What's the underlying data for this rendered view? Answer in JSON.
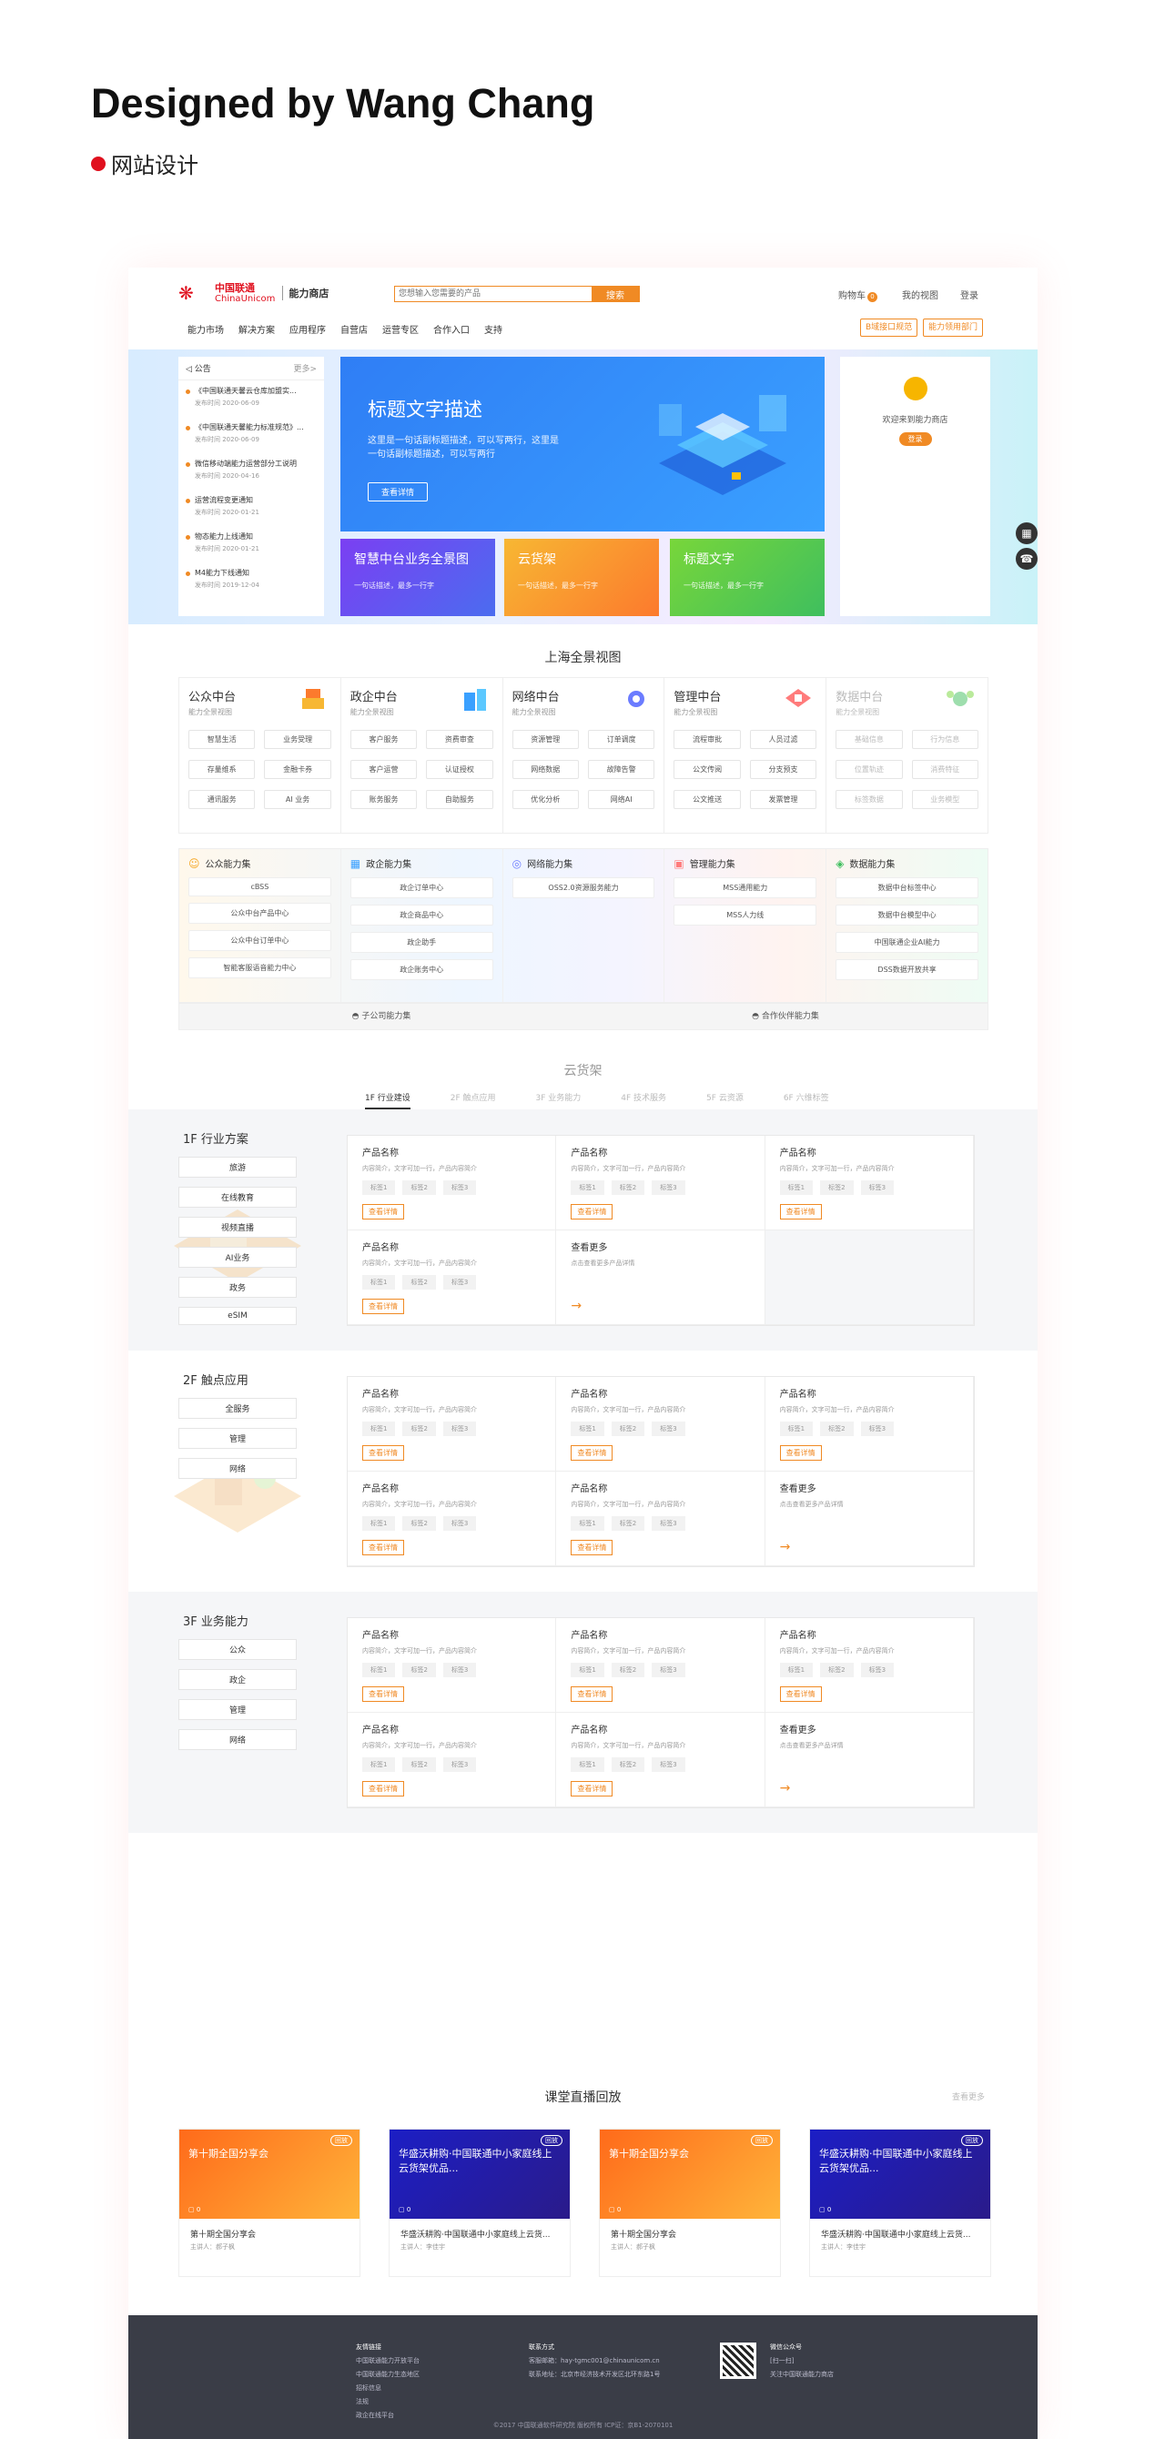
{
  "header": {
    "title": "Designed by Wang Chang",
    "subtitle": "网站设计"
  },
  "topbar": {
    "logo_cn": "中国联通",
    "logo_en": "ChinaUnicom",
    "logo_shop": "能力商店",
    "search_placeholder": "您想输入您需要的产品",
    "search_btn": "搜索",
    "cart": "购物车",
    "cart_count": "0",
    "my_view": "我的视图",
    "login": "登录"
  },
  "nav": {
    "items": [
      "能力市场",
      "解决方案",
      "应用程序",
      "自营店",
      "运营专区",
      "合作入口",
      "支持"
    ],
    "btn1": "B域接口规范",
    "btn2": "能力领用部门"
  },
  "notice": {
    "title": "公告",
    "more": "更多>",
    "items": [
      {
        "t": "《中国联通天馨云仓库加盟实...",
        "d": "发布时间 2020-06-09"
      },
      {
        "t": "《中国联通天馨能力标准规范》...",
        "d": "发布时间 2020-06-09"
      },
      {
        "t": "微信移动端能力运营部分工说明",
        "d": "发布时间 2020-04-16"
      },
      {
        "t": "运营流程变更通知",
        "d": "发布时间 2020-01-21"
      },
      {
        "t": "物态能力上线通知",
        "d": "发布时间 2020-01-21"
      },
      {
        "t": "M4能力下线通知",
        "d": "发布时间 2019-12-04"
      }
    ]
  },
  "banner": {
    "h": "标题文字描述",
    "p": "这里是一句话副标题描述，可以写两行，这里是一句话副标题描述，可以写两行",
    "btn": "查看详情"
  },
  "cards": [
    {
      "h": "智慧中台业务全景图",
      "p": "一句话描述，最多一行字",
      "color": "#6a4fe0"
    },
    {
      "h": "云货架",
      "p": "一句话描述，最多一行字",
      "color": "#f5a623"
    },
    {
      "h": "标题文字",
      "p": "一句话描述，最多一行字",
      "color": "#7ed321"
    }
  ],
  "rbox": {
    "welcome": "欢迎来到能力商店",
    "login": "登录"
  },
  "overview": {
    "title": "上海全景视图",
    "cols": [
      {
        "h": "公众中台",
        "s": "能力全景视图",
        "tags": [
          "智慧生活",
          "业务受理",
          "存量维系",
          "金融卡券",
          "通讯服务",
          "AI 业务"
        ]
      },
      {
        "h": "政企中台",
        "s": "能力全景视图",
        "tags": [
          "客户服务",
          "资费审查",
          "客户运营",
          "认证授权",
          "账务服务",
          "自助服务"
        ]
      },
      {
        "h": "网络中台",
        "s": "能力全景视图",
        "tags": [
          "资源管理",
          "订单调度",
          "网络数据",
          "故障告警",
          "优化分析",
          "网络AI"
        ]
      },
      {
        "h": "管理中台",
        "s": "能力全景视图",
        "tags": [
          "流程审批",
          "人员过滤",
          "公文传阅",
          "分支预支",
          "公文推送",
          "发票管理"
        ]
      },
      {
        "h": "数据中台",
        "s": "能力全景视图",
        "tags": [
          "基础信息",
          "行为信息",
          "位置轨迹",
          "消费特征",
          "标签数据",
          "业务模型"
        ]
      }
    ]
  },
  "caps": [
    {
      "h": "公众能力集",
      "icon": "☺",
      "items": [
        "cBSS",
        "公众中台产品中心",
        "公众中台订单中心",
        "智能客服语音能力中心"
      ]
    },
    {
      "h": "政企能力集",
      "icon": "▦",
      "items": [
        "政企订单中心",
        "政企商品中心",
        "政企助手",
        "政企账务中心"
      ]
    },
    {
      "h": "网络能力集",
      "icon": "◎",
      "items": [
        "OSS2.0资源服务能力"
      ]
    },
    {
      "h": "管理能力集",
      "icon": "▣",
      "items": [
        "MSS通用能力",
        "MSS人力线"
      ]
    },
    {
      "h": "数据能力集",
      "icon": "◈",
      "items": [
        "数据中台标签中心",
        "数据中台模型中心",
        "中国联通企业AI能力",
        "DSS数据开放共享"
      ]
    }
  ],
  "subbar": [
    "子公司能力集",
    "合作伙伴能力集"
  ],
  "shelf": {
    "title": "云货架",
    "tabs": [
      "1F 行业建设",
      "2F 触点应用",
      "3F 业务能力",
      "4F 技术服务",
      "5F 云资源",
      "6F 六维标签"
    ]
  },
  "floors": [
    {
      "label": "1F 行业方案",
      "btns": [
        "旅游",
        "在线教育",
        "视频直播",
        "AI业务",
        "政务",
        "eSIM"
      ]
    },
    {
      "label": "2F 触点应用",
      "btns": [
        "全服务",
        "管理",
        "网络"
      ]
    },
    {
      "label": "3F 业务能力",
      "btns": [
        "公众",
        "政企",
        "管理",
        "网络"
      ]
    }
  ],
  "product": {
    "name": "产品名称",
    "desc": "内容简介，文字可加一行，产品内容简介",
    "tags": [
      "标签1",
      "标签2",
      "标签3"
    ],
    "btn": "查看详情",
    "more": "查看更多",
    "more_desc": "点击查看更多产品详情",
    "arrow": "→"
  },
  "live": {
    "title": "课堂直播回放",
    "more": "查看更多",
    "badge": "回放",
    "items": [
      {
        "img": "第十期全国分享会",
        "t": "第十期全国分享会",
        "sp": "主讲人：郝子枫",
        "cnt": "▢ 0"
      },
      {
        "img": "华盛沃耕购·中国联通中小家庭线上云货架优品...",
        "t": "华盛沃耕购·中国联通中小家庭线上云货...",
        "sp": "主讲人：李佳宇",
        "cnt": "▢ 0"
      },
      {
        "img": "第十期全国分享会",
        "t": "第十期全国分享会",
        "sp": "主讲人：郝子枫",
        "cnt": "▢ 0"
      },
      {
        "img": "华盛沃耕购·中国联通中小家庭线上云货架优品...",
        "t": "华盛沃耕购·中国联通中小家庭线上云货...",
        "sp": "主讲人：李佳宇",
        "cnt": "▢ 0"
      }
    ]
  },
  "footer": {
    "col1": [
      "友情链接",
      "中国联通能力开放平台",
      "中国联通能力生态地区",
      "招标信息",
      "法规",
      "政企在线平台"
    ],
    "col2": [
      "联系方式",
      "客服邮箱：hay-tgmc001@chinaunicom.cn",
      "联系地址：北京市经济技术开发区北环东路1号"
    ],
    "col3": [
      "微信公众号",
      "[扫一扫]",
      "关注中国联通能力商店"
    ],
    "copy": "©2017 中国联通软件研究院 版权所有 ICP证：京B1-2070101"
  }
}
